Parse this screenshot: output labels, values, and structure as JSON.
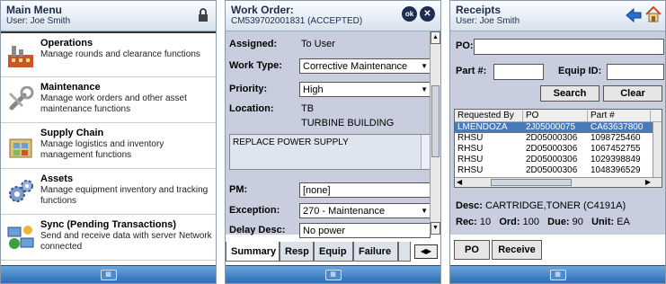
{
  "screen1": {
    "title": "Main Menu",
    "user": "User: Joe Smith",
    "items": [
      {
        "title": "Operations",
        "desc": "Manage rounds and clearance functions",
        "icon": "factory-icon"
      },
      {
        "title": "Maintenance",
        "desc": "Manage work orders and other asset maintenance functions",
        "icon": "wrench-icon"
      },
      {
        "title": "Supply Chain",
        "desc": "Manage logistics and inventory management functions",
        "icon": "warehouse-icon"
      },
      {
        "title": "Assets",
        "desc": "Manage equipment inventory and tracking functions",
        "icon": "gears-icon"
      },
      {
        "title": "Sync (Pending Transactions)",
        "desc": "Send and receive data with server Network connected",
        "icon": "sync-network-icon"
      }
    ]
  },
  "screen2": {
    "title": "Work Order:",
    "subtitle": "CM539702001831 (ACCEPTED)",
    "ok_label": "ok",
    "close_label": "✕",
    "assigned_label": "Assigned:",
    "assigned_value": "To User",
    "worktype_label": "Work Type:",
    "worktype_value": "Corrective Maintenance",
    "priority_label": "Priority:",
    "priority_value": "High",
    "location_label": "Location:",
    "location_code": "TB",
    "location_name": "TURBINE BUILDING",
    "description": "REPLACE POWER SUPPLY",
    "pm_label": "PM:",
    "pm_value": "[none]",
    "exception_label": "Exception:",
    "exception_value": "270 - Maintenance",
    "delay_label": "Delay Desc:",
    "delay_value": "No power",
    "tabs": [
      "Summary",
      "Resp",
      "Equip",
      "Failure"
    ]
  },
  "screen3": {
    "title": "Receipts",
    "user": "User: Joe Smith",
    "po_label": "PO:",
    "part_label": "Part #:",
    "equip_label": "Equip ID:",
    "search_label": "Search",
    "clear_label": "Clear",
    "columns": [
      "Requested By",
      "PO",
      "Part #"
    ],
    "rows": [
      [
        "LMENDOZA",
        "2J05000075",
        "CA63637800"
      ],
      [
        "RHSU",
        "2D05000306",
        "1098725460"
      ],
      [
        "RHSU",
        "2D05000306",
        "1067452755"
      ],
      [
        "RHSU",
        "2D05000306",
        "1029398849"
      ],
      [
        "RHSU",
        "2D05000306",
        "1048396529"
      ]
    ],
    "desc_label": "Desc:",
    "desc_value": "CARTRIDGE,TONER (C4191A)",
    "rec_label": "Rec:",
    "rec_value": "10",
    "ord_label": "Ord:",
    "ord_value": "100",
    "due_label": "Due:",
    "due_value": "90",
    "unit_label": "Unit:",
    "unit_value": "EA",
    "po_button": "PO",
    "receive_button": "Receive"
  },
  "colors": {
    "header_text": "#1c2c4a",
    "selected_row": "#4a7ab8",
    "form_bg": "#c8cedd",
    "taskbar": "#2d6db5"
  }
}
